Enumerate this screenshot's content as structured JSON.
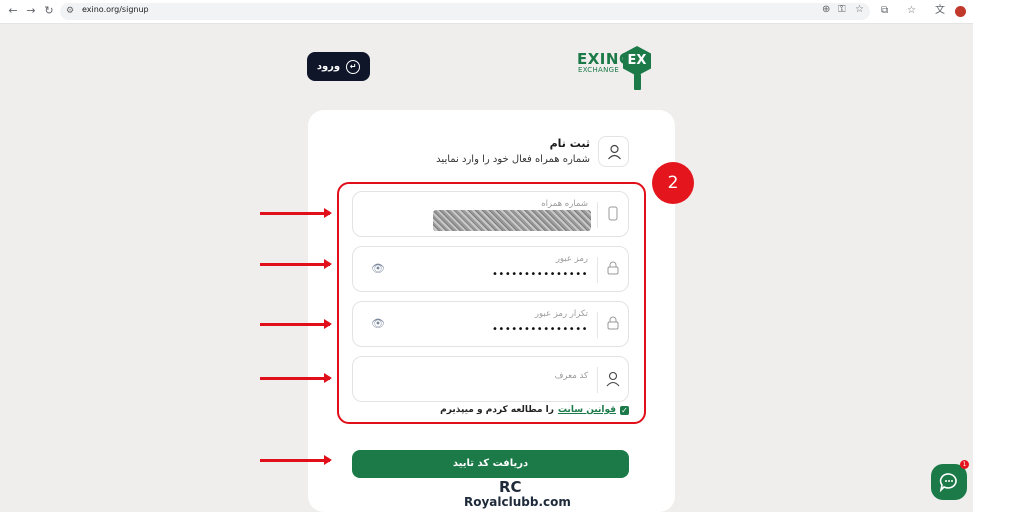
{
  "browser": {
    "url": "exino.org/signup",
    "icons": [
      "back-icon",
      "forward-icon",
      "reload-icon",
      "site-info-icon",
      "zoom-icon",
      "password-key-icon",
      "bookmark-star-icon",
      "extensions-icon",
      "favorites-icon",
      "translate-icon",
      "profile-avatar-icon"
    ]
  },
  "header": {
    "login_label": "ورود",
    "logo_word": "EXINO",
    "logo_sub": "EXCHANGE",
    "logo_badge": "EX"
  },
  "form": {
    "title": "ثبت نام",
    "subtitle": "شماره همراه فعال خود را وارد نمایید",
    "fields": [
      {
        "label": "شماره همراه",
        "value": "",
        "masked": true,
        "icon": "phone-icon"
      },
      {
        "label": "رمز عبور",
        "value": "•••••••••••••••",
        "icon": "lock-icon",
        "toggle_icon": "eye-icon"
      },
      {
        "label": "تکرار رمز عبور",
        "value": "•••••••••••••••",
        "icon": "lock-icon",
        "toggle_icon": "eye-icon"
      },
      {
        "label": "کد معرف",
        "value": "",
        "icon": "user-icon"
      }
    ],
    "terms_link": "قوانین سایت",
    "terms_text": "را مطالعه کردم و میپذیرم",
    "terms_checked": true,
    "submit_label": "دریافت کد تایید"
  },
  "annotation": {
    "step_number": "2",
    "color": "#e00f1a"
  },
  "watermark": {
    "mark": "RC",
    "text": "Royalclubb.com"
  },
  "chat": {
    "badge_count": "1"
  },
  "colors": {
    "brand_green": "#1b7a48",
    "dark_button": "#0f1629",
    "page_background": "#efeeec"
  }
}
